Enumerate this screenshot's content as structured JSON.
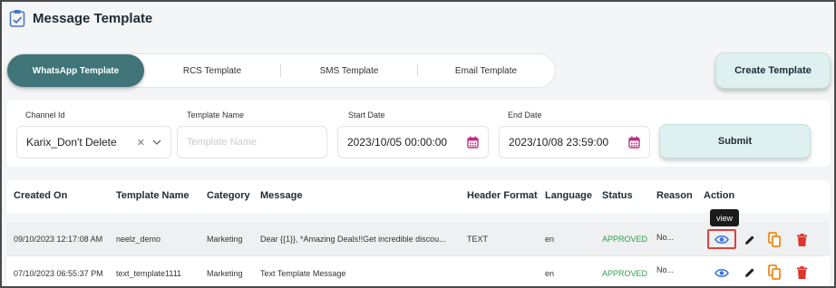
{
  "header": {
    "title": "Message Template",
    "icon": "clipboard-check-icon"
  },
  "tabs": [
    {
      "label": "WhatsApp Template",
      "active": true
    },
    {
      "label": "RCS Template",
      "active": false
    },
    {
      "label": "SMS Template",
      "active": false
    },
    {
      "label": "Email Template",
      "active": false
    }
  ],
  "create_button": "Create Template",
  "filters": {
    "channel_label": "Channel Id",
    "channel_value": "Karix_Don't Delete",
    "template_name_label": "Template Name",
    "template_name_placeholder": "Template Name",
    "start_label": "Start Date",
    "start_value": "2023/10/05 00:00:00",
    "end_label": "End Date",
    "end_value": "2023/10/08 23:59:00",
    "submit": "Submit"
  },
  "table": {
    "headers": [
      "Created On",
      "Template Name",
      "Category",
      "Message",
      "Header Format",
      "Language",
      "Status",
      "Reason",
      "Action"
    ],
    "rows": [
      {
        "created_on": "09/10/2023 12:17:08 AM",
        "template_name": "neelz_demo",
        "category": "Marketing",
        "message": "Dear {{1}}, *Amazing Deals!!Get incredible discou...",
        "header_format": "TEXT",
        "language": "en",
        "status": "APPROVED",
        "reason": "No..."
      },
      {
        "created_on": "07/10/2023 06:55:37 PM",
        "template_name": "text_template1111",
        "category": "Marketing",
        "message": "Text Template Message",
        "header_format": "",
        "language": "en",
        "status": "APPROVED",
        "reason": "No..."
      }
    ]
  },
  "tooltip": "view",
  "colors": {
    "accent": "#3f7478",
    "status_approved": "#2e9e4a",
    "view_icon": "#3b74e0",
    "copy_icon": "#f08a1c",
    "delete_icon": "#e0342c"
  }
}
